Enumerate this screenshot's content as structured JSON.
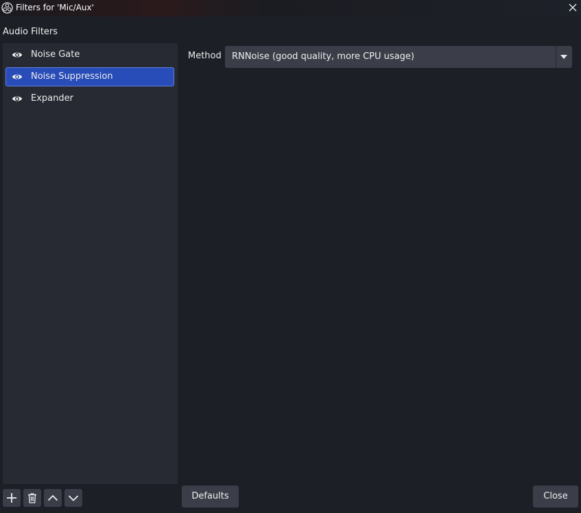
{
  "window": {
    "title": "Filters for 'Mic/Aux'"
  },
  "filters_section": {
    "label": "Audio Filters",
    "items": [
      {
        "label": "Noise Gate",
        "visible": true,
        "selected": false
      },
      {
        "label": "Noise Suppression",
        "visible": true,
        "selected": true
      },
      {
        "label": "Expander",
        "visible": true,
        "selected": false
      }
    ]
  },
  "properties": {
    "method_label": "Method",
    "method_value": "RNNoise (good quality, more CPU usage)"
  },
  "toolbar": {
    "icons": [
      "add-icon",
      "trash-icon",
      "chevron-up-icon",
      "chevron-down-icon"
    ]
  },
  "buttons": {
    "defaults_label": "Defaults",
    "close_label": "Close"
  },
  "colors": {
    "window_bg": "#1d1f26",
    "list_bg": "#272a33",
    "selected_bg": "#284cb8",
    "control_bg": "#3b3e49"
  }
}
